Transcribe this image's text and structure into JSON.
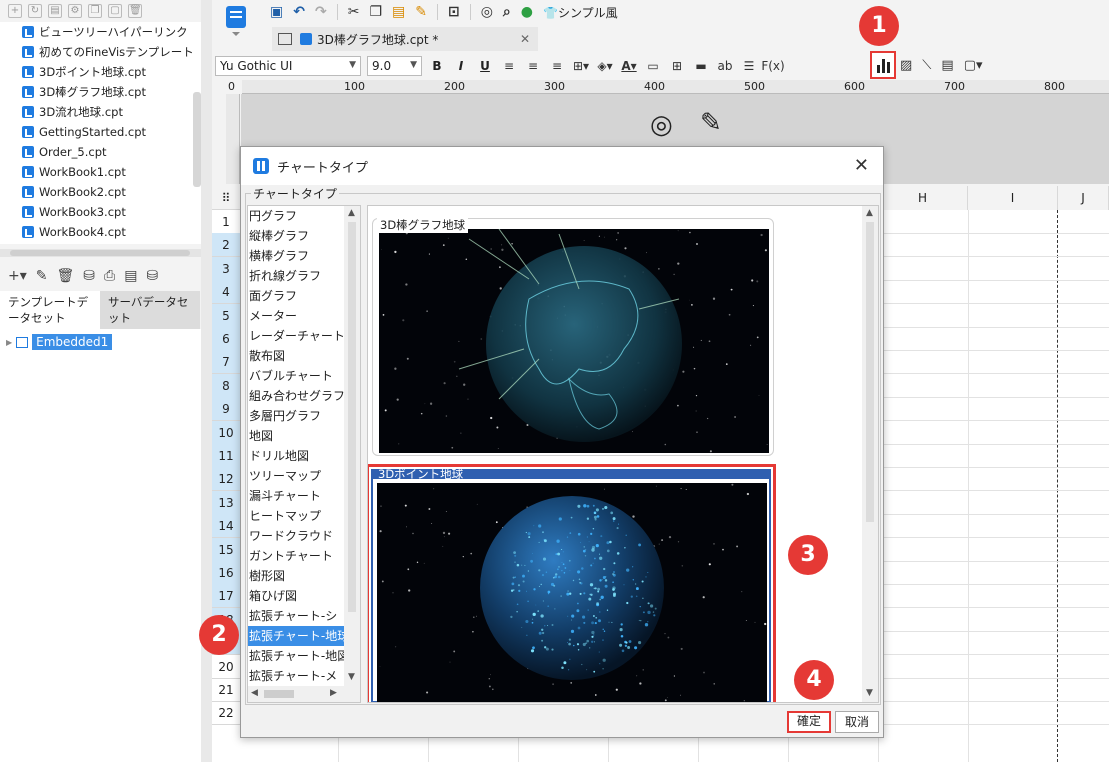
{
  "left_panel": {
    "files": [
      "ビューツリーハイパーリンク",
      "初めてのFineVisテンプレート",
      "3Dポイント地球.cpt",
      "3D棒グラフ地球.cpt",
      "3D流れ地球.cpt",
      "GettingStarted.cpt",
      "Order_5.cpt",
      "WorkBook1.cpt",
      "WorkBook2.cpt",
      "WorkBook3.cpt",
      "WorkBook4.cpt"
    ],
    "tabs": [
      "テンプレートデータセット",
      "サーバデータセット"
    ],
    "tree_item": "Embedded1"
  },
  "toolbar": {
    "style_label": "シンプル風",
    "font_name": "Yu Gothic UI",
    "font_size": "9.0",
    "bold": "B",
    "italic": "I",
    "underline": "U",
    "ab": "ab",
    "fx": "F(x)"
  },
  "doc_tab": {
    "title": "3D棒グラフ地球.cpt *"
  },
  "ruler": [
    "0",
    "100",
    "200",
    "300",
    "400",
    "500",
    "600",
    "700",
    "800"
  ],
  "columns": [
    "H",
    "I",
    "J"
  ],
  "rows": [
    "1",
    "2",
    "3",
    "4",
    "5",
    "6",
    "7",
    "8",
    "9",
    "10",
    "11",
    "12",
    "13",
    "14",
    "15",
    "16",
    "17",
    "18",
    "19",
    "20",
    "21",
    "22"
  ],
  "dialog": {
    "title": "チャートタイプ",
    "group_label": "チャートタイプ",
    "types": [
      "円グラフ",
      "縦棒グラフ",
      "横棒グラフ",
      "折れ線グラフ",
      "面グラフ",
      "メーター",
      "レーダーチャート",
      "散布図",
      "バブルチャート",
      "組み合わせグラフ",
      "多層円グラフ",
      "地図",
      "ドリル地図",
      "ツリーマップ",
      "漏斗チャート",
      "ヒートマップ",
      "ワードクラウド",
      "ガントチャート",
      "樹形図",
      "箱ひげ図",
      "拡張チャート-シ",
      "拡張チャート-地球",
      "拡張チャート-地図",
      "拡張チャート-メ"
    ],
    "selected_type_index": 21,
    "previews": [
      "3D棒グラフ地球",
      "3Dポイント地球"
    ],
    "ok": "確定",
    "cancel": "取消"
  },
  "badges": [
    "1",
    "2",
    "3",
    "4"
  ],
  "colors": {
    "accent_red": "#e53935",
    "selection_blue": "#3a8ee6",
    "brand_blue": "#1f7be0"
  }
}
